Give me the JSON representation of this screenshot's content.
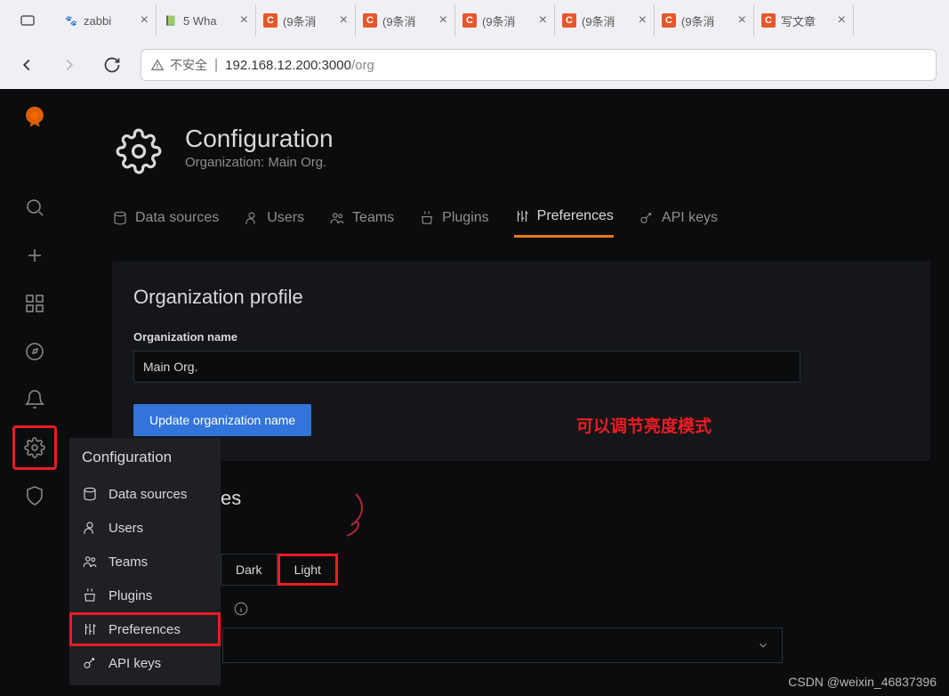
{
  "browser": {
    "tabs": [
      {
        "icon_style": "zabbix",
        "icon_text": "",
        "title": "zabbi"
      },
      {
        "icon_style": "csdn-green",
        "icon_text": "",
        "title": "5 Wha"
      },
      {
        "icon_style": "orange",
        "icon_text": "C",
        "title": "(9条消"
      },
      {
        "icon_style": "orange",
        "icon_text": "C",
        "title": "(9条消"
      },
      {
        "icon_style": "orange",
        "icon_text": "C",
        "title": "(9条消"
      },
      {
        "icon_style": "orange",
        "icon_text": "C",
        "title": "(9条消"
      },
      {
        "icon_style": "orange",
        "icon_text": "C",
        "title": "(9条消"
      },
      {
        "icon_style": "orange",
        "icon_text": "C",
        "title": "写文章"
      }
    ],
    "security_label": "不安全",
    "url_host": "192.168.12.200:",
    "url_port": "3000",
    "url_path": "/org"
  },
  "header": {
    "title": "Configuration",
    "subtitle": "Organization: Main Org."
  },
  "tabs": {
    "data_sources": "Data sources",
    "users": "Users",
    "teams": "Teams",
    "plugins": "Plugins",
    "preferences": "Preferences",
    "api_keys": "API keys"
  },
  "panel": {
    "title": "Organization profile",
    "org_name_label": "Organization name",
    "org_name_value": "Main Org.",
    "update_btn": "Update organization name"
  },
  "annotation": "可以调节亮度模式",
  "flyout": {
    "title": "Configuration",
    "data_sources": "Data sources",
    "users": "Users",
    "teams": "Teams",
    "plugins": "Plugins",
    "preferences": "Preferences",
    "api_keys": "API keys"
  },
  "theme": {
    "dark": "Dark",
    "light": "Light"
  },
  "fragments": {
    "es": "es"
  },
  "watermark": "CSDN @weixin_46837396"
}
